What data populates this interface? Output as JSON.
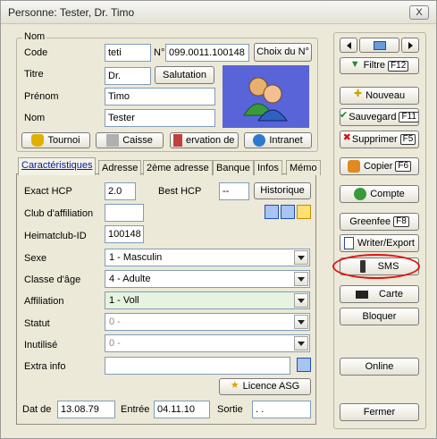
{
  "window": {
    "title": "Personne: Tester, Dr. Timo",
    "close": "X"
  },
  "nom_group": {
    "title": "Nom",
    "code_label": "Code",
    "code_value": "teti",
    "number_label": "N°",
    "number_value": "099.0011.100148",
    "choix_button": "Choix du N°",
    "titre_label": "Titre",
    "titre_value": "Dr.",
    "salutation_button": "Salutation",
    "prenom_label": "Prénom",
    "prenom_value": "Timo",
    "nom_label": "Nom",
    "nom_value": "Tester",
    "tournoi_button": "Tournoi",
    "caisse_button": "Caisse",
    "reservation_button": "ervation de d",
    "intranet_button": "Intranet"
  },
  "tabs": [
    "Caractéristiques",
    "Adresse",
    "2ème adresse",
    "Banque",
    "Infos",
    "Mémo"
  ],
  "form": {
    "exact_hcp_label": "Exact HCP",
    "exact_hcp_value": "2.0",
    "best_hcp_label": "Best HCP",
    "best_hcp_value": "--",
    "historique_button": "Historique",
    "club_label": "Club d'affiliation",
    "club_value": "",
    "heimatclub_label": "Heimatclub-ID",
    "heimatclub_value": "100148",
    "sexe_label": "Sexe",
    "sexe_value": "1 - Masculin",
    "classe_label": "Classe d'âge",
    "classe_value": "4 - Adulte",
    "affiliation_label": "Affiliation",
    "affiliation_value": "1 - Voll",
    "statut_label": "Statut",
    "statut_value": "0 -",
    "inutilise_label": "Inutilisé",
    "inutilise_value": "0 -",
    "extra_label": "Extra info",
    "extra_value": "",
    "licence_button": "Licence ASG",
    "dat_label": "Dat de",
    "dat_value": "13.08.79",
    "entree_label": "Entrée",
    "entree_value": "04.11.10",
    "sortie_label": "Sortie",
    "sortie_value": ". ."
  },
  "right_panel": {
    "filtre": "Filtre",
    "filtre_key": "F12",
    "nouveau": "Nouveau",
    "sauvegard": "Sauvegard",
    "sauvegard_key": "F11",
    "supprimer": "Supprimer",
    "supprimer_key": "F5",
    "copier": "Copier",
    "copier_key": "F6",
    "compte": "Compte",
    "greenfee": "Greenfee",
    "greenfee_key": "F8",
    "writer": "Writer/Export",
    "sms": "SMS",
    "carte": "Carte",
    "bloquer": "Bloquer",
    "online": "Online",
    "fermer": "Fermer"
  }
}
